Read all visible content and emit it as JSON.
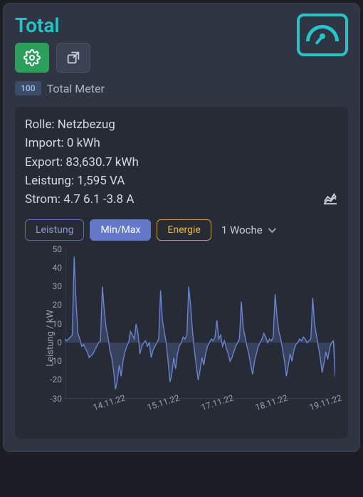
{
  "title": "Total",
  "toolbar": {
    "settings_icon": "gear-icon",
    "external_icon": "open-external-icon"
  },
  "big_icon": "meter-gauge-icon",
  "badge_value": "100",
  "meter_label": "Total Meter",
  "stats": {
    "role_label": "Rolle:",
    "role_value": "Netzbezug",
    "import_label": "Import:",
    "import_value": "0 kWh",
    "export_label": "Export:",
    "export_value": "83,630.7 kWh",
    "power_label": "Leistung:",
    "power_value": "1,595 VA",
    "current_label": "Strom:",
    "current_value": "4.7 6.1 -3.8 A"
  },
  "chart_icon": "line-chart-icon",
  "tabs": {
    "leistung": "Leistung",
    "minmax": "Min/Max",
    "energie": "Energie"
  },
  "range": {
    "label": "1 Woche"
  },
  "chart_data": {
    "type": "line",
    "title": "",
    "xlabel": "",
    "ylabel": "Leistung / kW",
    "ylim": [
      -30,
      50
    ],
    "yticks": [
      50,
      40,
      30,
      20,
      10,
      0,
      -10,
      -20,
      -30
    ],
    "x_categories": [
      "14.11.22",
      "15.11.22",
      "17.11.22",
      "18.11.22",
      "19.11.22"
    ],
    "series": [
      {
        "name": "Leistung",
        "values": [
          2,
          1,
          2,
          3,
          4,
          46,
          22,
          5,
          2,
          -2,
          -1,
          -3,
          -5,
          -8,
          -7,
          -6,
          -4,
          -2,
          0,
          1,
          30,
          18,
          8,
          3,
          -4,
          -8,
          -15,
          -25,
          -20,
          -12,
          -18,
          -10,
          -5,
          -2,
          0,
          6,
          4,
          2,
          10,
          5,
          -6,
          -2,
          0,
          1,
          -2,
          0,
          -8,
          -4,
          -2,
          0,
          2,
          28,
          12,
          6,
          0,
          -10,
          -21,
          -17,
          -8,
          -14,
          -6,
          -2,
          0,
          3,
          2,
          4,
          30,
          20,
          6,
          -4,
          -12,
          -20,
          -15,
          -8,
          -12,
          -6,
          -2,
          0,
          2,
          1,
          3,
          12,
          2,
          4,
          -2,
          1,
          -3,
          -6,
          -10,
          -8,
          -5,
          -2,
          0,
          2,
          22,
          8,
          3,
          -2,
          -6,
          -12,
          -17,
          -10,
          -6,
          -2,
          0,
          2,
          5,
          3,
          0,
          2,
          1,
          3,
          26,
          14,
          6,
          2,
          -4,
          -10,
          -18,
          -12,
          -6,
          -10,
          -4,
          -1,
          0,
          2,
          1,
          3,
          2,
          0,
          1,
          2,
          24,
          10,
          4,
          -2,
          -8,
          -16,
          -11,
          -5,
          -9,
          -3,
          0,
          1,
          -18
        ]
      }
    ]
  }
}
